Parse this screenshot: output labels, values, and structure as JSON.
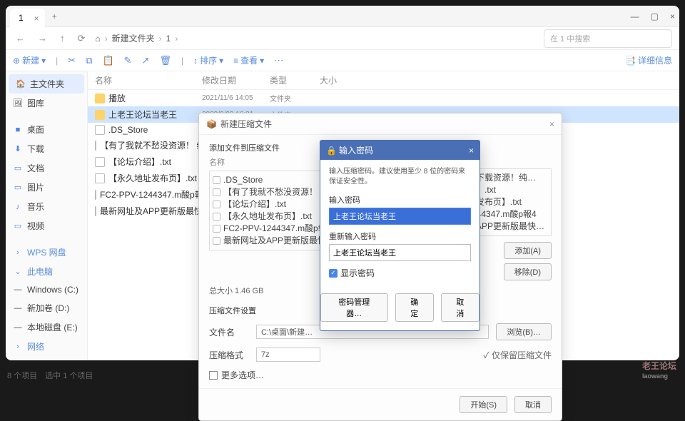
{
  "tab": {
    "title": "1"
  },
  "breadcrumb": {
    "seg1": "新建文件夹",
    "seg2": "1"
  },
  "search": {
    "placeholder": "在 1 中搜索"
  },
  "toolbar": {
    "new": "新建",
    "sort": "排序",
    "view": "查看",
    "details": "详细信息"
  },
  "sidebar": {
    "items": [
      {
        "label": "主文件夹",
        "icon": "🏠"
      },
      {
        "label": "图库",
        "icon": "🖼"
      },
      {
        "label": "桌面",
        "icon": "🖥"
      },
      {
        "label": "下载",
        "icon": "⬇"
      },
      {
        "label": "文档",
        "icon": "📄"
      },
      {
        "label": "图片",
        "icon": "🖼"
      },
      {
        "label": "音乐",
        "icon": "🎵"
      },
      {
        "label": "视频",
        "icon": "🎬"
      },
      {
        "label": "WPS 网盘",
        "icon": "☁"
      },
      {
        "label": "此电脑",
        "icon": "💻"
      },
      {
        "label": "Windows (C:)",
        "icon": "—"
      },
      {
        "label": "新加卷 (D:)",
        "icon": "—"
      },
      {
        "label": "本地磁盘 (E:)",
        "icon": "—"
      },
      {
        "label": "网络",
        "icon": "🌐"
      }
    ]
  },
  "columns": {
    "name": "名称",
    "date": "修改日期",
    "type": "类型",
    "size": "大小"
  },
  "files": [
    {
      "name": "播放",
      "date": "2021/11/6 14:05",
      "type": "文件夹",
      "folder": true
    },
    {
      "name": "上老王论坛当老王",
      "date": "2023/2/23 16:31",
      "type": "文件夹",
      "folder": true,
      "selected": true
    },
    {
      "name": ".DS_Store",
      "date": "",
      "type": ""
    },
    {
      "name": "【有了我就不愁没资源！ 纯免费！】.txt",
      "date": "",
      "type": ""
    },
    {
      "name": "【论坛介绍】.txt",
      "date": "",
      "type": ""
    },
    {
      "name": "【永久地址发布页】.txt",
      "date": "",
      "type": ""
    },
    {
      "name": "FC2-PPV-1244347.m酸p報4",
      "date": "",
      "type": ""
    },
    {
      "name": "最新网址及APP更新版最快最全讯1！！！.txt",
      "date": "",
      "type": ""
    }
  ],
  "status": {
    "text": "8 个项目　选中 1 个项目"
  },
  "dlg1": {
    "title": "新建压缩文件",
    "addLabel": "添加文件到压缩文件",
    "nameCol": "名称",
    "list": [
      ".DS_Store",
      "【有了我就不愁没资源！ 纯免费…",
      "【论坛介绍】.txt",
      "【永久地址发布页】.txt",
      "FC2-PPV-1244347.m酸p報4",
      "最新网址及APP更新版最快最全讯…"
    ],
    "rightList": [
      "播放下载资源！纯…",
      "介绍】.txt",
      "地址发布页】.txt",
      "V-1244347.m酸p報4",
      "址及APP更新版最快…"
    ],
    "totalSize": "总大小 1.46 GB",
    "addBtn": "添加(A)",
    "delBtn": "移除(D)",
    "section": "压缩文件设置",
    "fileName": "文件名",
    "fileNameVal": "C:\\桌面\\新建…",
    "format": "压缩格式",
    "formatVal": "7z",
    "moreChk": "更多选项…",
    "browse": "浏览(B)…",
    "okBtn": "开始(S)",
    "cancel": "取消",
    "autoDel": "✓ 仅保留压缩文件"
  },
  "dlg2": {
    "title": "输入密码",
    "hint": "输入压缩密码。建议使用至少 8 位的密码来保证安全性。",
    "lbl1": "输入密码",
    "val1": "上老王论坛当老王",
    "lbl2": "重新输入密码",
    "val2": "上老王论坛当老王",
    "show": "显示密码",
    "mgr": "密码管理器…",
    "ok": "确定",
    "cancel": "取消"
  },
  "watermark": {
    "big": "老王论坛",
    "small": "laowang"
  }
}
